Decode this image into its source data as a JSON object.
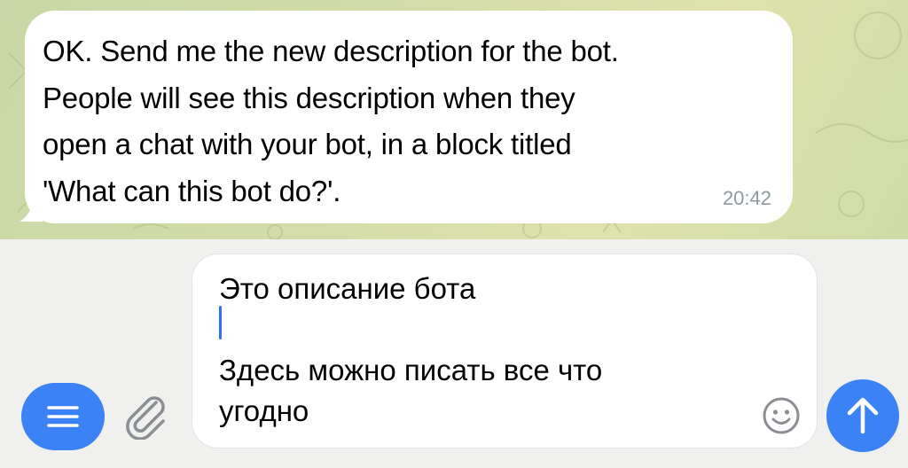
{
  "incoming_message": {
    "text": "OK. Send me the new description for the bot.\nPeople will see this description when they\nopen a chat with your bot, in a block titled\n'What can this bot do?'.",
    "time": "20:42"
  },
  "composer": {
    "draft_text": "Это описание бота\n\nЗдесь можно писать все что\nугодно",
    "menu_icon": "menu-lines-icon",
    "attach_icon": "paperclip-icon",
    "emoji_icon": "smiley-icon",
    "send_icon": "arrow-up-icon"
  },
  "colors": {
    "accent": "#3a82f6",
    "bubble": "#ffffff",
    "time": "#8e9a9f",
    "caret": "#2f6fe8"
  }
}
